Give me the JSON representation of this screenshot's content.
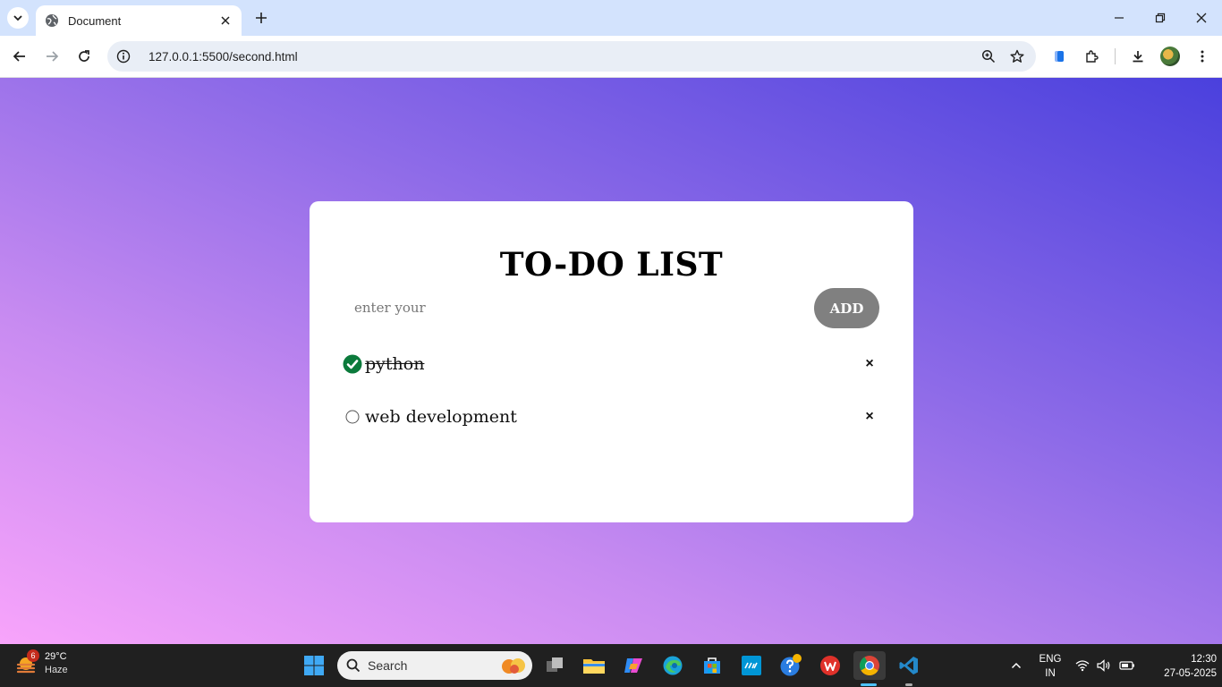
{
  "browser": {
    "tab_title": "Document",
    "url": "127.0.0.1:5500/second.html"
  },
  "app": {
    "title": "TO-DO LIST",
    "input_placeholder": "enter your",
    "add_label": "ADD",
    "remove_symbol": "×",
    "items": [
      {
        "text": "python",
        "done": true
      },
      {
        "text": "web development",
        "done": false
      }
    ]
  },
  "taskbar": {
    "weather_badge": "6",
    "temperature": "29°C",
    "condition": "Haze",
    "search_placeholder": "Search",
    "language_1": "ENG",
    "language_2": "IN",
    "time": "12:30",
    "date": "27-05-2025"
  },
  "colors": {
    "background_gradient": [
      "#f8a4fb",
      "#c88bf1",
      "#8e6be8",
      "#4a40dd"
    ],
    "add_button": "#808080",
    "done_check": "#0b7a3b"
  }
}
